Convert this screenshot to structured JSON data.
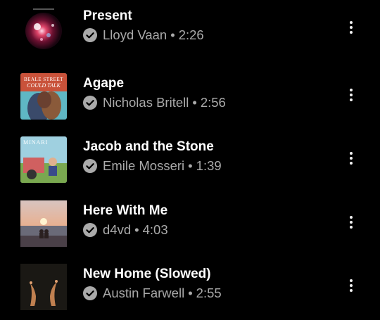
{
  "tracks": [
    {
      "title": "Present",
      "artist": "Lloyd Vaan",
      "duration": "2:26",
      "thumb_icon": "nebula-album-art"
    },
    {
      "title": "Agape",
      "artist": "Nicholas Britell",
      "duration": "2:56",
      "thumb_icon": "beale-street-album-art",
      "thumb_text": [
        "BEALE STREET",
        "COULD TALK"
      ]
    },
    {
      "title": "Jacob and the Stone",
      "artist": "Emile Mosseri",
      "duration": "1:39",
      "thumb_icon": "minari-album-art",
      "thumb_text": "MINARI"
    },
    {
      "title": "Here With Me",
      "artist": "d4vd",
      "duration": "4:03",
      "thumb_icon": "sunset-couple-album-art"
    },
    {
      "title": "New Home (Slowed)",
      "artist": "Austin Farwell",
      "duration": "2:55",
      "thumb_icon": "hands-album-art"
    }
  ],
  "separator": "•",
  "colors": {
    "background": "#000000",
    "title": "#ffffff",
    "subtitle": "#aaaaaa"
  }
}
